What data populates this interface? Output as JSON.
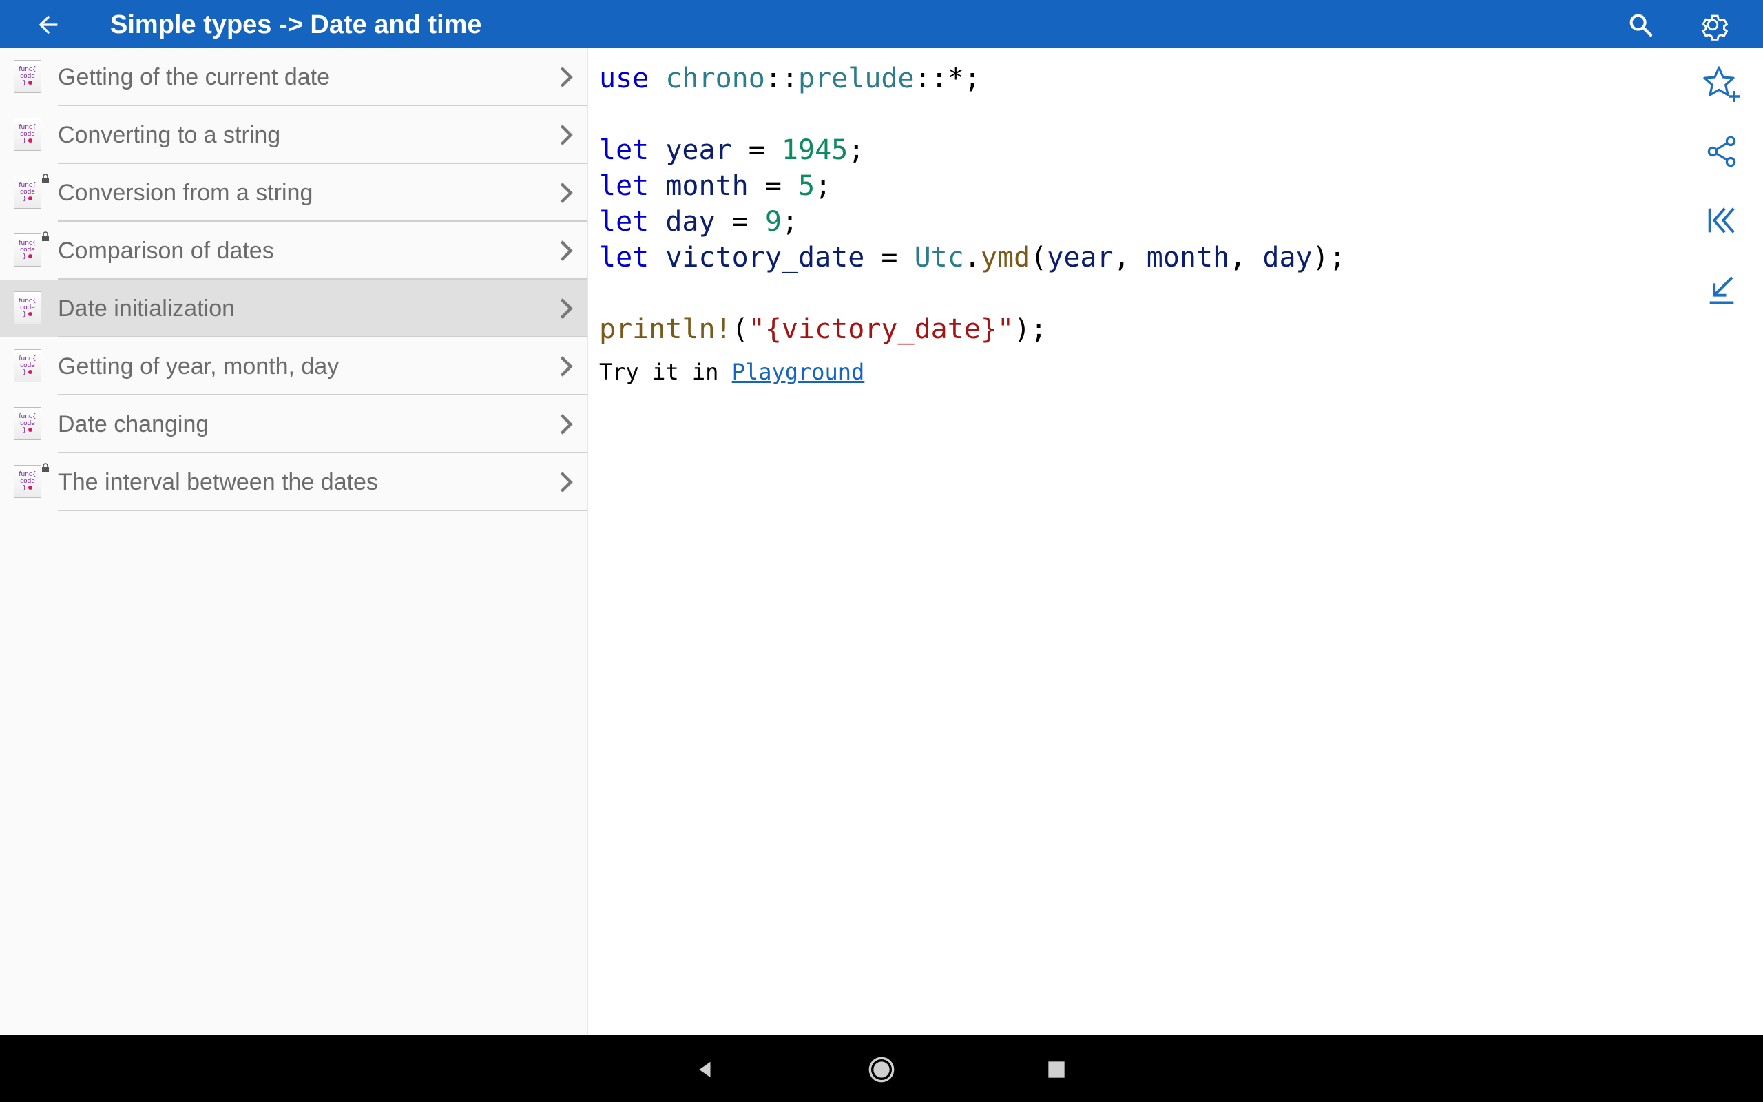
{
  "app_bar": {
    "title": "Simple types -> Date and time",
    "icons": [
      "back-arrow-icon",
      "search-icon",
      "gear-icon"
    ]
  },
  "sidebar": {
    "items": [
      {
        "label": "Getting of the current date",
        "locked": false,
        "selected": false
      },
      {
        "label": "Converting to a string",
        "locked": false,
        "selected": false
      },
      {
        "label": "Conversion from a string",
        "locked": true,
        "selected": false
      },
      {
        "label": "Comparison of dates",
        "locked": true,
        "selected": false
      },
      {
        "label": "Date initialization",
        "locked": false,
        "selected": true
      },
      {
        "label": "Getting of year, month, day",
        "locked": false,
        "selected": false
      },
      {
        "label": "Date changing",
        "locked": false,
        "selected": false
      },
      {
        "label": "The interval between the dates",
        "locked": true,
        "selected": false
      }
    ],
    "item_icon_text": [
      "func{",
      "code",
      "}"
    ]
  },
  "code": {
    "line1": {
      "kw": "use",
      "path1": "chrono",
      "sep1": "::",
      "path2": "prelude",
      "sep2": "::",
      "rest": "*;"
    },
    "line3": {
      "kw": "let",
      "name": "year",
      "eq": " = ",
      "num": "1945",
      "end": ";"
    },
    "line4": {
      "kw": "let",
      "name": "month",
      "eq": " = ",
      "num": "5",
      "end": ";"
    },
    "line5": {
      "kw": "let",
      "name": "day",
      "eq": " = ",
      "num": "9",
      "end": ";"
    },
    "line6": {
      "kw": "let",
      "name": "victory_date",
      "eq": " = ",
      "type": "Utc",
      "dot": ".",
      "fn": "ymd",
      "open": "(",
      "a1": "year",
      "c1": ", ",
      "a2": "month",
      "c2": ", ",
      "a3": "day",
      "close": ");"
    },
    "line8": {
      "macro": "println!",
      "open": "(",
      "str": "\"{victory_date}\"",
      "close": ");"
    }
  },
  "try_it": {
    "prefix": "Try it in ",
    "link": "Playground"
  },
  "actions": [
    "star-plus-icon",
    "share-icon",
    "collapse-left-icon",
    "download-icon"
  ],
  "navigation_bar": [
    "nav-back-icon",
    "nav-home-icon",
    "nav-recents-icon"
  ],
  "colors": {
    "app_bar": "#1565c0",
    "keyword": "#0000cc",
    "type": "#2b7d8c",
    "number": "#0d8a5e",
    "string": "#a31515",
    "function": "#7a5a1a"
  }
}
